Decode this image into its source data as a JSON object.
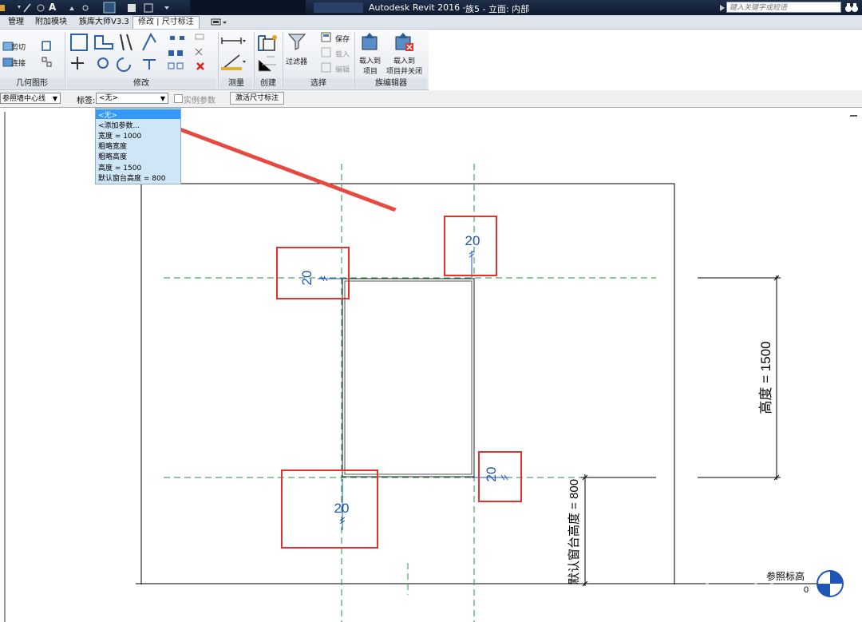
{
  "titlebar": {
    "app_title": "Autodesk Revit 2016 -",
    "doc_title": "族5 - 立面: 内部",
    "search_placeholder": "键入关键字或短语",
    "qa_letter": "A"
  },
  "tabs": [
    {
      "label": "管理"
    },
    {
      "label": "附加模块"
    },
    {
      "label": "族库大师V3.3"
    },
    {
      "label": "修改 | 尺寸标注",
      "active": true
    }
  ],
  "ribbon": {
    "geometry": {
      "title": "几何图形",
      "cut": "剪切",
      "join": "连接"
    },
    "modify": {
      "title": "修改"
    },
    "measure": {
      "title": "测量"
    },
    "create": {
      "title": "创建"
    },
    "select": {
      "title": "选择",
      "filter": "过滤器",
      "save": "保存",
      "load": "载入",
      "edit": "编辑"
    },
    "family_editor": {
      "title": "族编辑器",
      "load_into_project": "载入到\n项目",
      "load_close": "载入到\n项目并关闭",
      "load_into_project_l1": "载入到",
      "load_into_project_l2": "项目",
      "load_close_l1": "载入到",
      "load_close_l2": "项目并关闭"
    }
  },
  "options_bar": {
    "ref_value": "参照墙中心线",
    "label_caption": "标签:",
    "label_value": "<无>",
    "instance_param": "实例参数",
    "activate_button": "激活尺寸标注"
  },
  "label_dropdown": {
    "items": [
      "<无>",
      "<添加参数...",
      "宽度 = 1000",
      "粗略宽度",
      "粗略高度",
      "高度 = 1500",
      "默认窗台高度 = 800"
    ],
    "selected_index": 0
  },
  "drawing": {
    "dim_values": [
      "20",
      "20",
      "20",
      "20"
    ],
    "height_label": "高度 = 1500",
    "sill_label": "默认窗台高度 = 800",
    "ref_level_name": "参照标高",
    "ref_level_value": "0"
  },
  "colors": {
    "titlebar": "#142238",
    "active_tab": "#ffffff",
    "ref_plane": "#1e9a3e",
    "dimension_text": "#1f55b5",
    "highlight_box": "#e3322e",
    "arrow": "#e8483f",
    "dropdown_bg": "#cfe6f6",
    "dropdown_selected": "#3399ff"
  }
}
